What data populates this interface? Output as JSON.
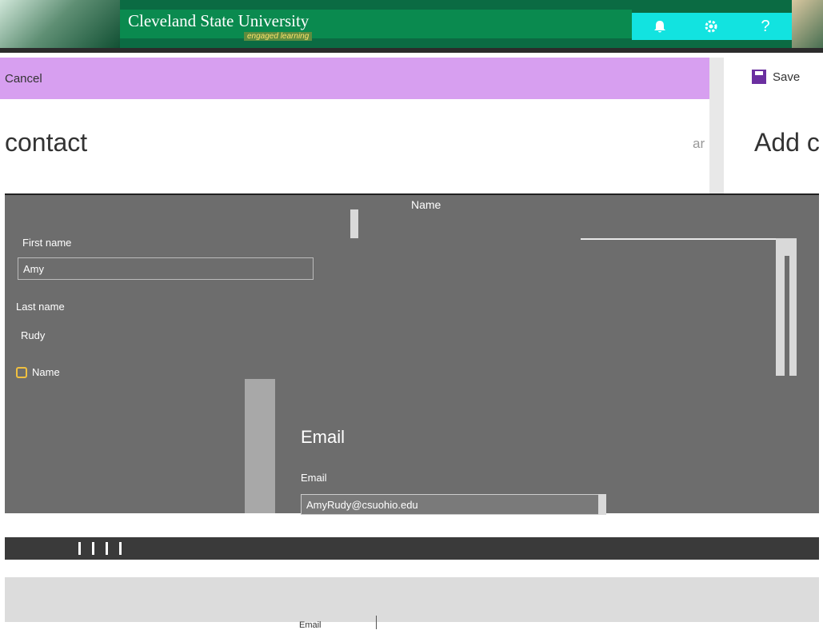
{
  "header": {
    "university": "Cleveland State University",
    "tagline": "engaged learning",
    "icons": [
      "bell-icon",
      "gear-icon",
      "help-icon"
    ],
    "help_glyph": "?"
  },
  "command_bar": {
    "cancel_label": "Cancel",
    "save_label": "Save",
    "accent_color": "#d79ff0"
  },
  "page": {
    "title": "contact",
    "right_title": "Add c",
    "right_fragment": "ar"
  },
  "form": {
    "tab_label": "Name",
    "first_name_label": "First name",
    "first_name_value": "Amy",
    "last_name_label": "Last name",
    "last_name_value": "Rudy",
    "name_section_label": "Name",
    "email_heading": "Email",
    "email_label": "Email",
    "email_value": "AmyRudy@csuohio.edu"
  },
  "footer": {
    "email_link": "Email"
  }
}
